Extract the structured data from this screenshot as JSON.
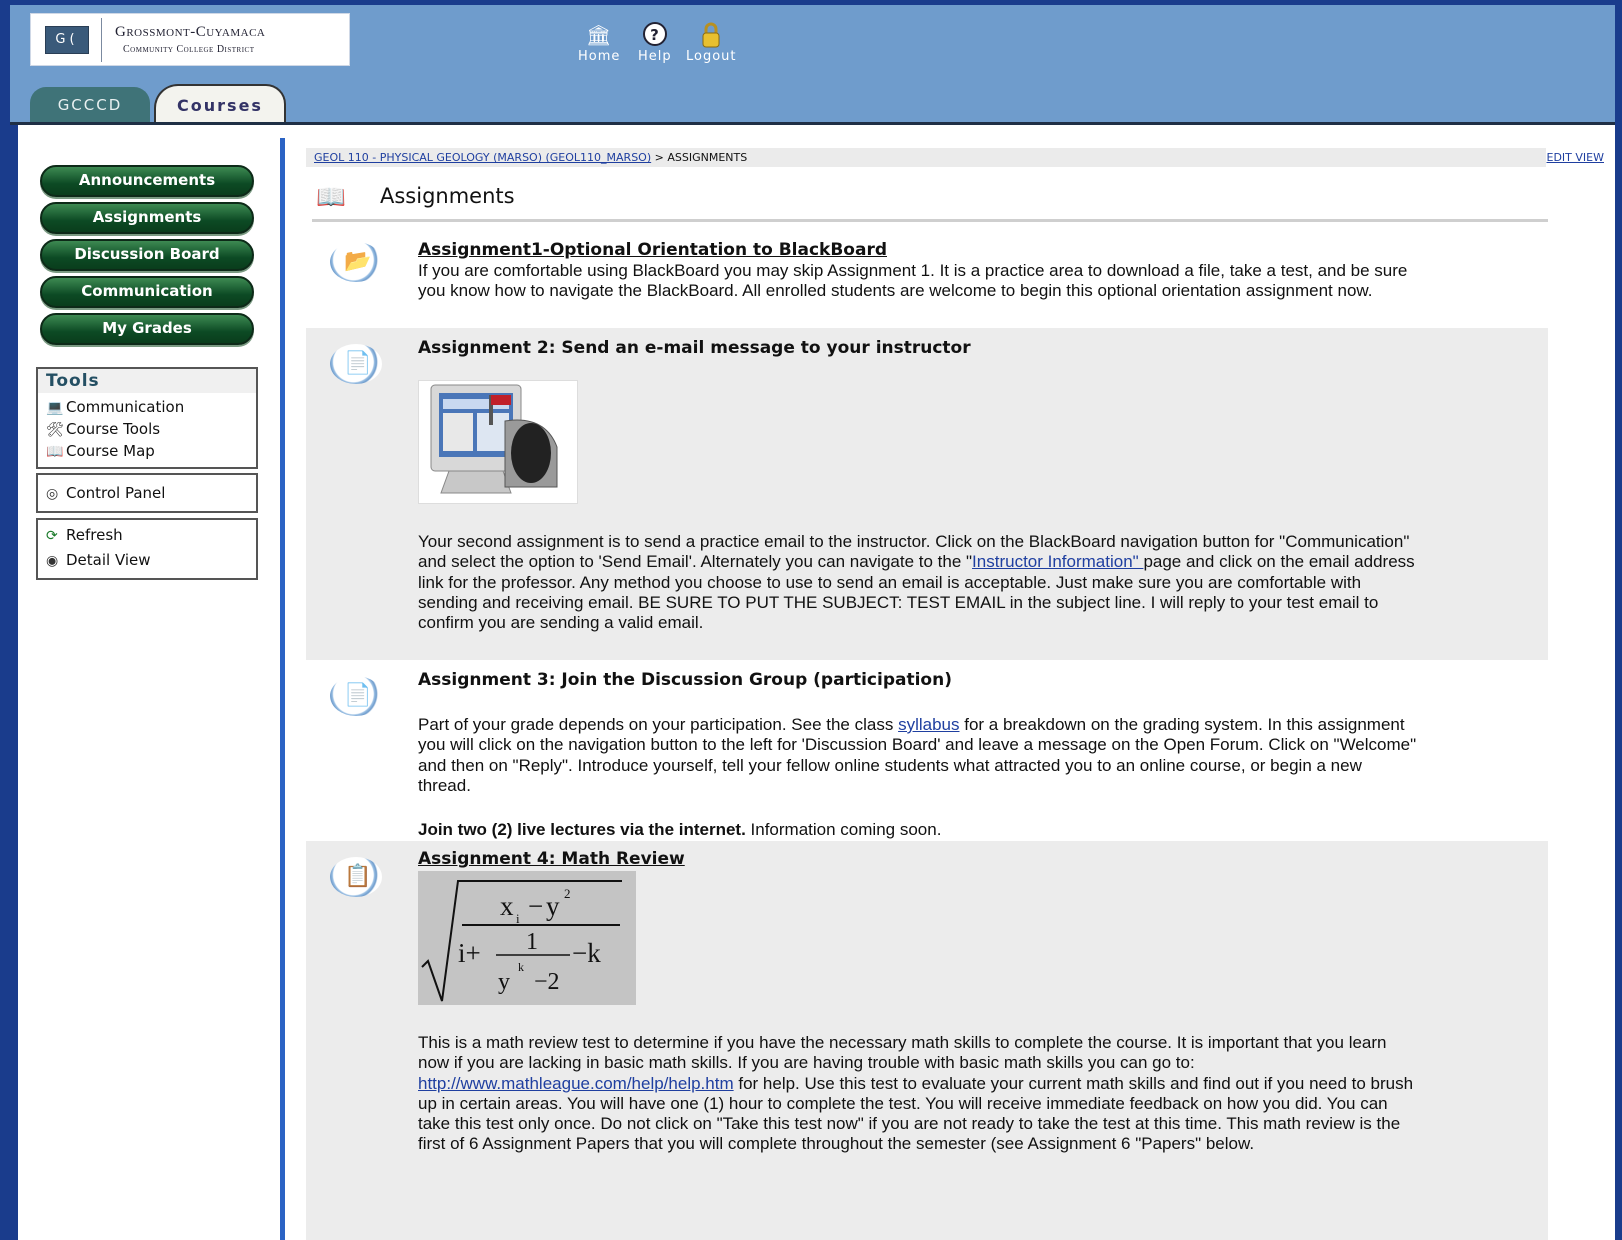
{
  "logo": {
    "name": "Grossmont-Cuyamaca",
    "subtitle": "Community College District"
  },
  "top_nav": [
    {
      "label": "Home",
      "icon": "home-icon"
    },
    {
      "label": "Help",
      "icon": "help-icon"
    },
    {
      "label": "Logout",
      "icon": "lock-icon"
    }
  ],
  "tabs": {
    "gcccd": "GCCCD",
    "courses": "Courses"
  },
  "sidebar": {
    "buttons": [
      "Announcements",
      "Assignments",
      "Discussion Board",
      "Communication",
      "My Grades"
    ],
    "tools_title": "Tools",
    "tools": [
      "Communication",
      "Course Tools",
      "Course Map"
    ],
    "control_panel": "Control Panel",
    "refresh": "Refresh",
    "detail_view": "Detail View"
  },
  "breadcrumb": {
    "course_link": "GEOL 110 - PHYSICAL GEOLOGY (MARSO) (GEOL110_MARSO)",
    "separator": " > ",
    "current": "ASSIGNMENTS"
  },
  "edit_view": "EDIT VIEW",
  "page_title": "Assignments",
  "items": {
    "a1": {
      "title": "Assignment1-Optional Orientation to BlackBoard",
      "text": "If you are comfortable using BlackBoard you may skip Assignment 1.  It is a practice area to download a file, take a test, and be sure you know how to navigate the BlackBoard. All enrolled students are welcome to begin this optional orientation assignment now."
    },
    "a2": {
      "title": "Assignment 2: Send an e-mail message to your instructor",
      "text_before": " Your second assignment is to send a practice email to the instructor.  Click on the BlackBoard navigation button for \"Communication\" and select the option to 'Send Email'.  Alternately you can navigate to the \"",
      "link": "Instructor Information\" ",
      "text_after": " page and click on the email address link for the professor.  Any method you choose to use to send an email is acceptable.  Just make sure you are comfortable with sending and receiving email. BE SURE TO PUT THE SUBJECT: TEST EMAIL in the subject line.  I will reply to your test  email to confirm you are sending a valid email."
    },
    "a3": {
      "title": "Assignment 3: Join the Discussion Group (participation)",
      "text_before": "Part of your grade depends on your participation.  See the class ",
      "link": "syllabus",
      "text_after": " for a breakdown on the grading system. In this assignment you will click on the navigation button to the left for 'Discussion Board' and leave a message on the Open Forum.  Click on \"Welcome\" and then on \"Reply\".  Introduce yourself, tell your fellow online students what attracted you to an online course, or begin a new thread.",
      "join_bold": "Join two (2) live lectures via the internet.",
      "join_text": "  Information coming soon."
    },
    "a4": {
      "title": "Assignment 4: Math Review",
      "formula": {
        "num_x": "x",
        "sub_i": "i",
        "minus": "−",
        "num_y": "y",
        "sup_2": "2",
        "den_i": "i+",
        "one": "1",
        "den_y": "y",
        "sup_k": "k",
        "den_m2": "−2",
        "den_k": "−k"
      },
      "text_before": "This is a math review test to determine if you have the necessary math skills to complete the course.  It is important that you learn now if you are lacking in basic math skills.  If you are having trouble with basic math skills you can go to: ",
      "link": "http://www.mathleague.com/help/help.htm",
      "text_after": " for help.  Use this test to evaluate your current math skills and find out if you need to brush up in certain areas. You will have one (1) hour to complete the test.  You will receive immediate feedback on how you did.  You can take this test only once.  Do not click on \"Take this test now\" if you are not ready to take the test at this time. This math review is the first of 6 Assignment Papers that you will complete throughout the semester (see Assignment 6 \"Papers\" below."
    }
  },
  "colors": {
    "header": "#6f9ccc",
    "nav_button": "#0c4a24",
    "frame": "#1a3c8c",
    "link": "#1f3fa0"
  }
}
